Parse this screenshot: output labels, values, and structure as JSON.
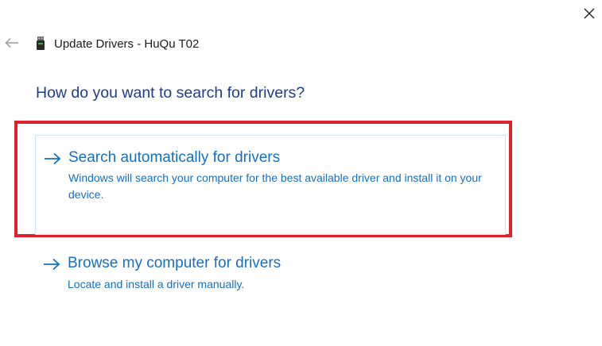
{
  "window": {
    "title": "Update Drivers - HuQu T02",
    "close_icon": "close-icon",
    "back_icon": "back-arrow-icon",
    "device_icon": "usb-device-icon"
  },
  "heading": "How do you want to search for drivers?",
  "options": [
    {
      "title": "Search automatically for drivers",
      "description": "Windows will search your computer for the best available driver and install it on your device.",
      "icon": "arrow-right-icon"
    },
    {
      "title": "Browse my computer for drivers",
      "description": "Locate and install a driver manually.",
      "icon": "arrow-right-icon"
    }
  ],
  "colors": {
    "heading": "#1e3c8c",
    "link": "#1570c1",
    "highlight": "#e0202a"
  }
}
